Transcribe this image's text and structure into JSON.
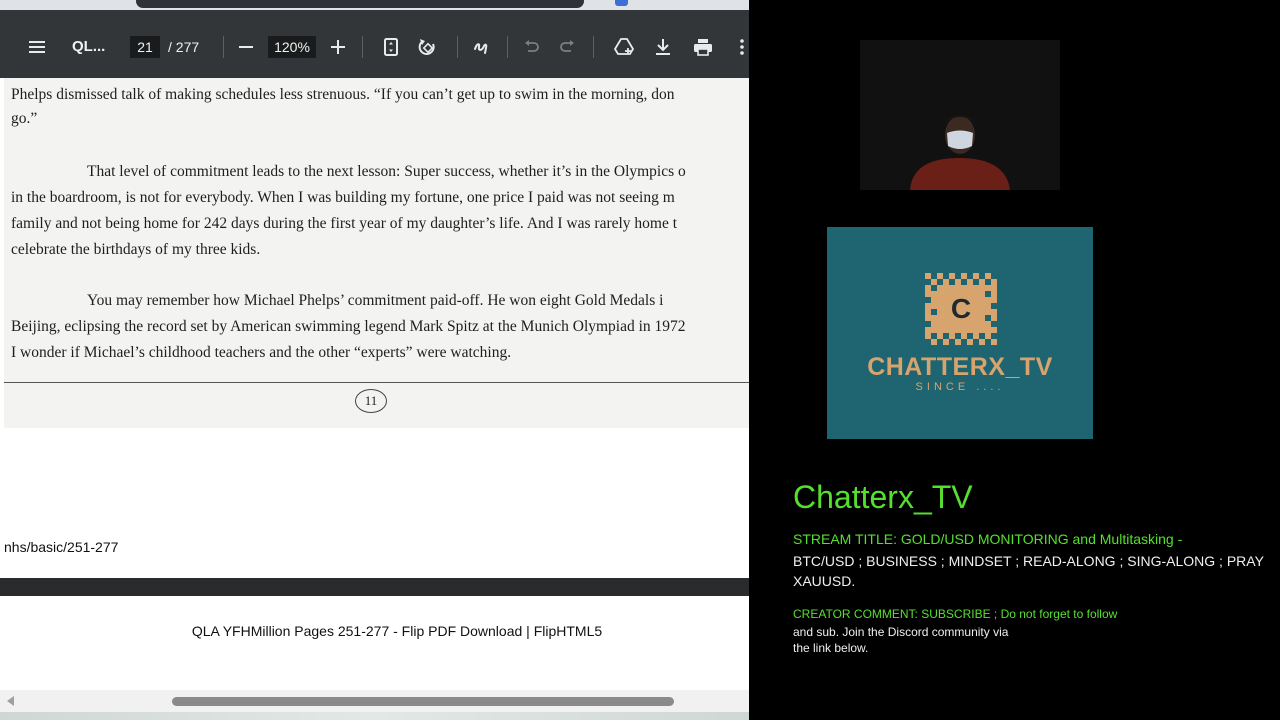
{
  "pdf_viewer": {
    "doc_title": "QL...",
    "current_page": "21",
    "total_pages": "/ 277",
    "zoom": "120%",
    "icons": [
      "menu-icon",
      "zoom-out-icon",
      "zoom-in-icon",
      "fit-page-icon",
      "rotate-icon",
      "annotate-icon",
      "undo-icon",
      "redo-icon",
      "save-to-drive-icon",
      "download-icon",
      "print-icon",
      "more-options-icon"
    ],
    "page_text": [
      "Phelps dismissed talk of making schedules less strenuous.  “If you can’t get up to swim in the morning, don",
      "go.”",
      "That level of commitment leads to the next lesson: Super success, whether it’s in the Olympics o",
      "in the boardroom, is not for everybody.  When I was building my fortune, one price I paid was not seeing m",
      "family and not being home for 242 days during the first year of my daughter’s life.  And I was rarely home t",
      "celebrate the birthdays of my three kids.",
      "You may remember how Michael Phelps’ commitment paid-off.  He won eight Gold Medals i",
      "Beijing, eclipsing the record set by American swimming legend Mark Spitz at the Munich Olympiad in 1972",
      "I wonder if Michael’s childhood teachers and the other “experts” were watching."
    ],
    "page_number": "11",
    "url_fragment": "nhs/basic/251-277"
  },
  "page_footer": {
    "title": "QLA YFHMillion Pages 251-277 - Flip PDF Download | FlipHTML5"
  },
  "stream_overlay": {
    "logo": {
      "name": "CHATTERX_TV",
      "since": "SINCE ....",
      "letter": "C",
      "colors": {
        "background": "#1f6571",
        "accent": "#d8a46e"
      }
    },
    "channel_name": "Chatterx_TV",
    "stream_title": "STREAM TITLE: GOLD/USD MONITORING and Multitasking -",
    "stream_desc": "BTC/USD ; BUSINESS ; MINDSET ; READ-ALONG ; SING-ALONG ; PRAY XAUUSD.",
    "creator_comment": "CREATOR COMMENT: SUBSCRIBE ; Do not forget to follow",
    "comment_body": "and sub. Join the Discord community via the link below.",
    "colors": {
      "highlight": "#55e02f",
      "text": "#f0f0f0"
    }
  }
}
